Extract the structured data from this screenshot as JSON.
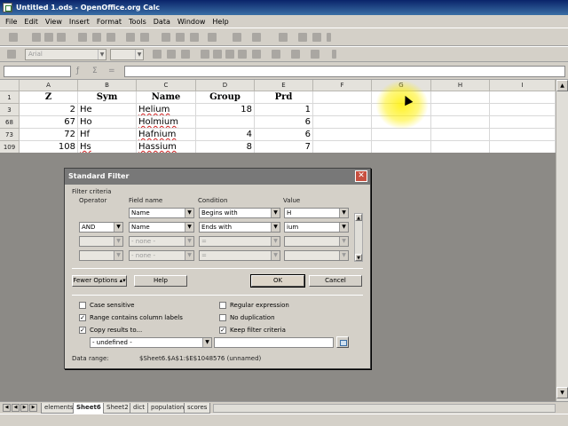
{
  "window": {
    "title": "Untitled 1.ods - OpenOffice.org Calc"
  },
  "menu": [
    "File",
    "Edit",
    "View",
    "Insert",
    "Format",
    "Tools",
    "Data",
    "Window",
    "Help"
  ],
  "toolbar": {
    "font_name": "Arial"
  },
  "columns": [
    "A",
    "B",
    "C",
    "D",
    "E",
    "F",
    "G",
    "H",
    "I"
  ],
  "rows": [
    {
      "num": "1",
      "cells": [
        "Z",
        "Sym",
        "Name",
        "Group",
        "Prd"
      ]
    },
    {
      "num": "3",
      "cells": [
        "2",
        "He",
        "Helium",
        "18",
        "1"
      ]
    },
    {
      "num": "68",
      "cells": [
        "67",
        "Ho",
        "Holmium",
        "",
        "6"
      ]
    },
    {
      "num": "73",
      "cells": [
        "72",
        "Hf",
        "Hafnium",
        "4",
        "6"
      ]
    },
    {
      "num": "109",
      "cells": [
        "108",
        "Hs",
        "Hassium",
        "8",
        "7"
      ]
    }
  ],
  "sheet_tabs": [
    "elements",
    "Sheet6",
    "Sheet2",
    "dict",
    "population",
    "scores"
  ],
  "active_tab": "Sheet6",
  "dialog": {
    "title": "Standard Filter",
    "criteria_label": "Filter criteria",
    "headers": {
      "operator": "Operator",
      "field": "Field name",
      "condition": "Condition",
      "value": "Value"
    },
    "criteria": [
      {
        "operator": "",
        "field": "Name",
        "condition": "Begins with",
        "value": "H"
      },
      {
        "operator": "AND",
        "field": "Name",
        "condition": "Ends with",
        "value": "ium"
      },
      {
        "operator": "",
        "field": "- none -",
        "condition": "=",
        "value": ""
      },
      {
        "operator": "",
        "field": "- none -",
        "condition": "=",
        "value": ""
      }
    ],
    "buttons": {
      "fewer": "Fewer Options",
      "help": "Help",
      "ok": "OK",
      "cancel": "Cancel"
    },
    "options": {
      "case_sensitive": "Case sensitive",
      "range_labels": "Range contains column labels",
      "copy_results": "Copy results to...",
      "regex": "Regular expression",
      "no_dup": "No duplication",
      "keep": "Keep filter criteria"
    },
    "copy_target": "- undefined -",
    "data_range_label": "Data range:",
    "data_range_value": "$Sheet6.$A$1:$E$1048576 (unnamed)"
  }
}
